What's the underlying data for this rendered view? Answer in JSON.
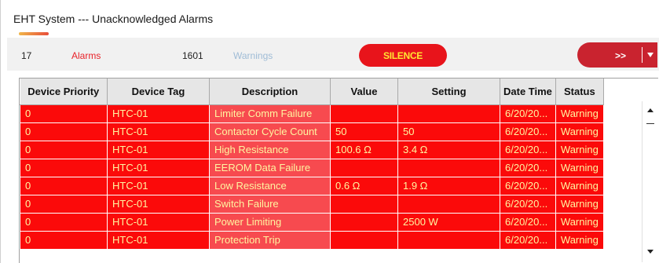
{
  "window": {
    "title": "EHT System --- Unacknowledged Alarms"
  },
  "summary": {
    "alarm_count": "17",
    "alarm_label": "Alarms",
    "warning_count": "1601",
    "warning_label": "Warnings",
    "silence_label": "SILENCE",
    "next_label": ">>"
  },
  "colors": {
    "row_red": "#fb0a0a",
    "desc_cell": "#f74a4f",
    "cell_text": "#fff5a0",
    "silence_text": "#ffe633",
    "alarm_label": "#e8232a",
    "warning_label": "#9fbcd6"
  },
  "table": {
    "columns": [
      "Device Priority",
      "Device Tag",
      "Description",
      "Value",
      "Setting",
      "Date Time",
      "Status"
    ],
    "rows": [
      [
        "0",
        "HTC-01",
        "Limiter Comm Failure",
        "",
        "",
        "6/20/20...",
        "Warning"
      ],
      [
        "0",
        "HTC-01",
        "Contactor Cycle Count",
        "50",
        "50",
        "6/20/20...",
        "Warning"
      ],
      [
        "0",
        "HTC-01",
        "High Resistance",
        "100.6 Ω",
        "3.4 Ω",
        "6/20/20...",
        "Warning"
      ],
      [
        "0",
        "HTC-01",
        "EEROM Data Failure",
        "",
        "",
        "6/20/20...",
        "Warning"
      ],
      [
        "0",
        "HTC-01",
        "Low Resistance",
        "0.6 Ω",
        "1.9 Ω",
        "6/20/20...",
        "Warning"
      ],
      [
        "0",
        "HTC-01",
        "Switch Failure",
        "",
        "",
        "6/20/20...",
        "Warning"
      ],
      [
        "0",
        "HTC-01",
        "Power Limiting",
        "",
        "2500 W",
        "6/20/20...",
        "Warning"
      ],
      [
        "0",
        "HTC-01",
        "Protection Trip",
        "",
        "",
        "6/20/20...",
        "Warning"
      ]
    ]
  },
  "icons": {
    "dropdown": "chevron-down-icon",
    "scroll_up": "scroll-up-arrow-icon",
    "scroll_down": "scroll-down-arrow-icon"
  }
}
